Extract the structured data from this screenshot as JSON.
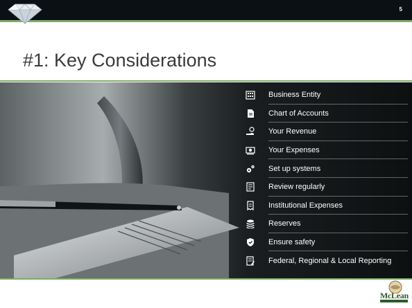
{
  "slide": {
    "number": "5",
    "title": "#1: Key Considerations"
  },
  "considerations": [
    {
      "icon": "building-icon",
      "label": "Business Entity"
    },
    {
      "icon": "document-icon",
      "label": "Chart of Accounts"
    },
    {
      "icon": "hand-coin-icon",
      "label": "Your Revenue"
    },
    {
      "icon": "cash-icon",
      "label": "Your Expenses"
    },
    {
      "icon": "gears-icon",
      "label": "Set up systems"
    },
    {
      "icon": "checklist-icon",
      "label": "Review regularly"
    },
    {
      "icon": "receipt-icon",
      "label": "Institutional Expenses"
    },
    {
      "icon": "coin-stack-icon",
      "label": "Reserves"
    },
    {
      "icon": "shield-icon",
      "label": "Ensure safety"
    },
    {
      "icon": "report-icon",
      "label": "Federal, Regional & Local Reporting"
    }
  ],
  "logo": {
    "text": "McLean"
  },
  "colors": {
    "accent": "#7faa6a",
    "topbar": "#0b1014",
    "title": "#3a3a3a"
  }
}
